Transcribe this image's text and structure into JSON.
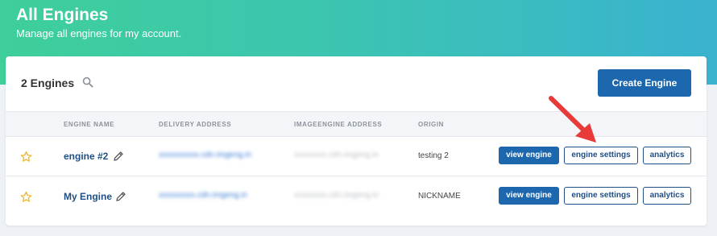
{
  "header": {
    "title": "All Engines",
    "subtitle": "Manage all engines for my account."
  },
  "toolbar": {
    "count_label": "2 Engines",
    "create_label": "Create Engine"
  },
  "table": {
    "columns": [
      "ENGINE NAME",
      "DELIVERY ADDRESS",
      "IMAGEENGINE ADDRESS",
      "ORIGIN"
    ],
    "rows": [
      {
        "name": "engine #2",
        "delivery": "xxxxxxxxxx.cdn.imgeng.in",
        "imageengine": "xxxxxxxx.cdn.imgeng.in",
        "origin": "testing 2"
      },
      {
        "name": "My Engine",
        "delivery": "xxxxxxxxx.cdn.imgeng.in",
        "imageengine": "xxxxxxxx.cdn.imgeng.in",
        "origin": "NICKNAME"
      }
    ],
    "actions": {
      "view": "view engine",
      "settings": "engine settings",
      "analytics": "analytics"
    }
  },
  "colors": {
    "accent_blue": "#1c67ad",
    "link_blue": "#1f4f85",
    "star": "#f0b323",
    "arrow": "#e93a3a"
  }
}
